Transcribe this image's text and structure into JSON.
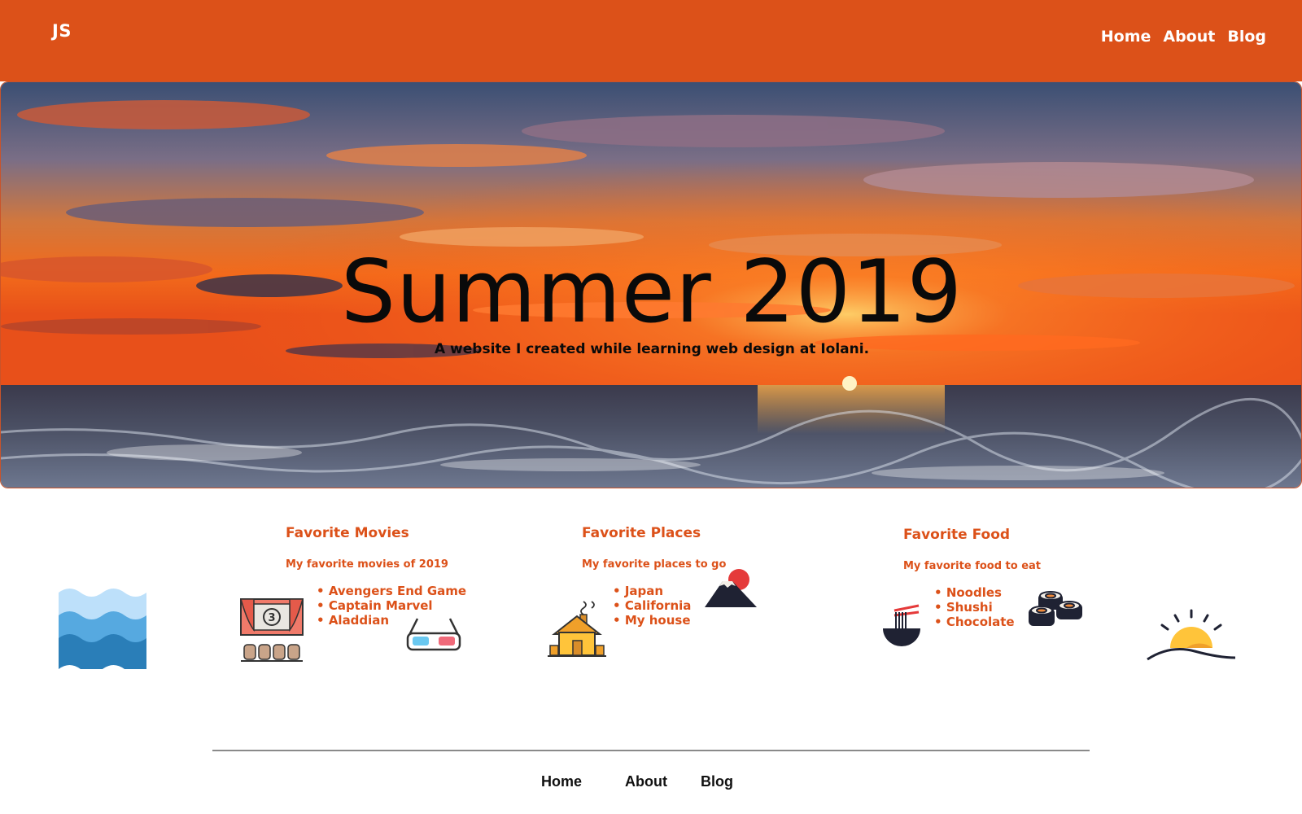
{
  "header": {
    "logo": "JS",
    "nav": [
      "Home",
      "About",
      "Blog"
    ],
    "background_color": "#dc5119"
  },
  "hero": {
    "title": "Summer 2019",
    "subtitle": "A website I created while learning web design at Iolani.",
    "background": "sunset over ocean photo"
  },
  "cards": [
    {
      "title": "Favorite Movies",
      "description": "My favorite movies of 2019",
      "items": [
        "Avengers End Game",
        "Captain Marvel",
        "Aladdian"
      ],
      "icons": [
        "movie-theater-icon",
        "3d-glasses-icon"
      ]
    },
    {
      "title": "Favorite Places",
      "description": "My favorite places to go",
      "items": [
        "Japan",
        "California",
        "My house"
      ],
      "icons": [
        "house-icon",
        "mount-fuji-icon"
      ]
    },
    {
      "title": "Favorite Food",
      "description": "My favorite food to eat",
      "items": [
        "Noodles",
        "Shushi",
        "Chocolate"
      ],
      "icons": [
        "noodle-bowl-icon",
        "sushi-icon"
      ]
    }
  ],
  "decorations": [
    "waves-icon",
    "sunrise-icon"
  ],
  "footer": {
    "nav": [
      "Home",
      "About",
      "Blog"
    ]
  },
  "colors": {
    "accent": "#dc5119",
    "footer_rule": "#8a8a8a"
  }
}
